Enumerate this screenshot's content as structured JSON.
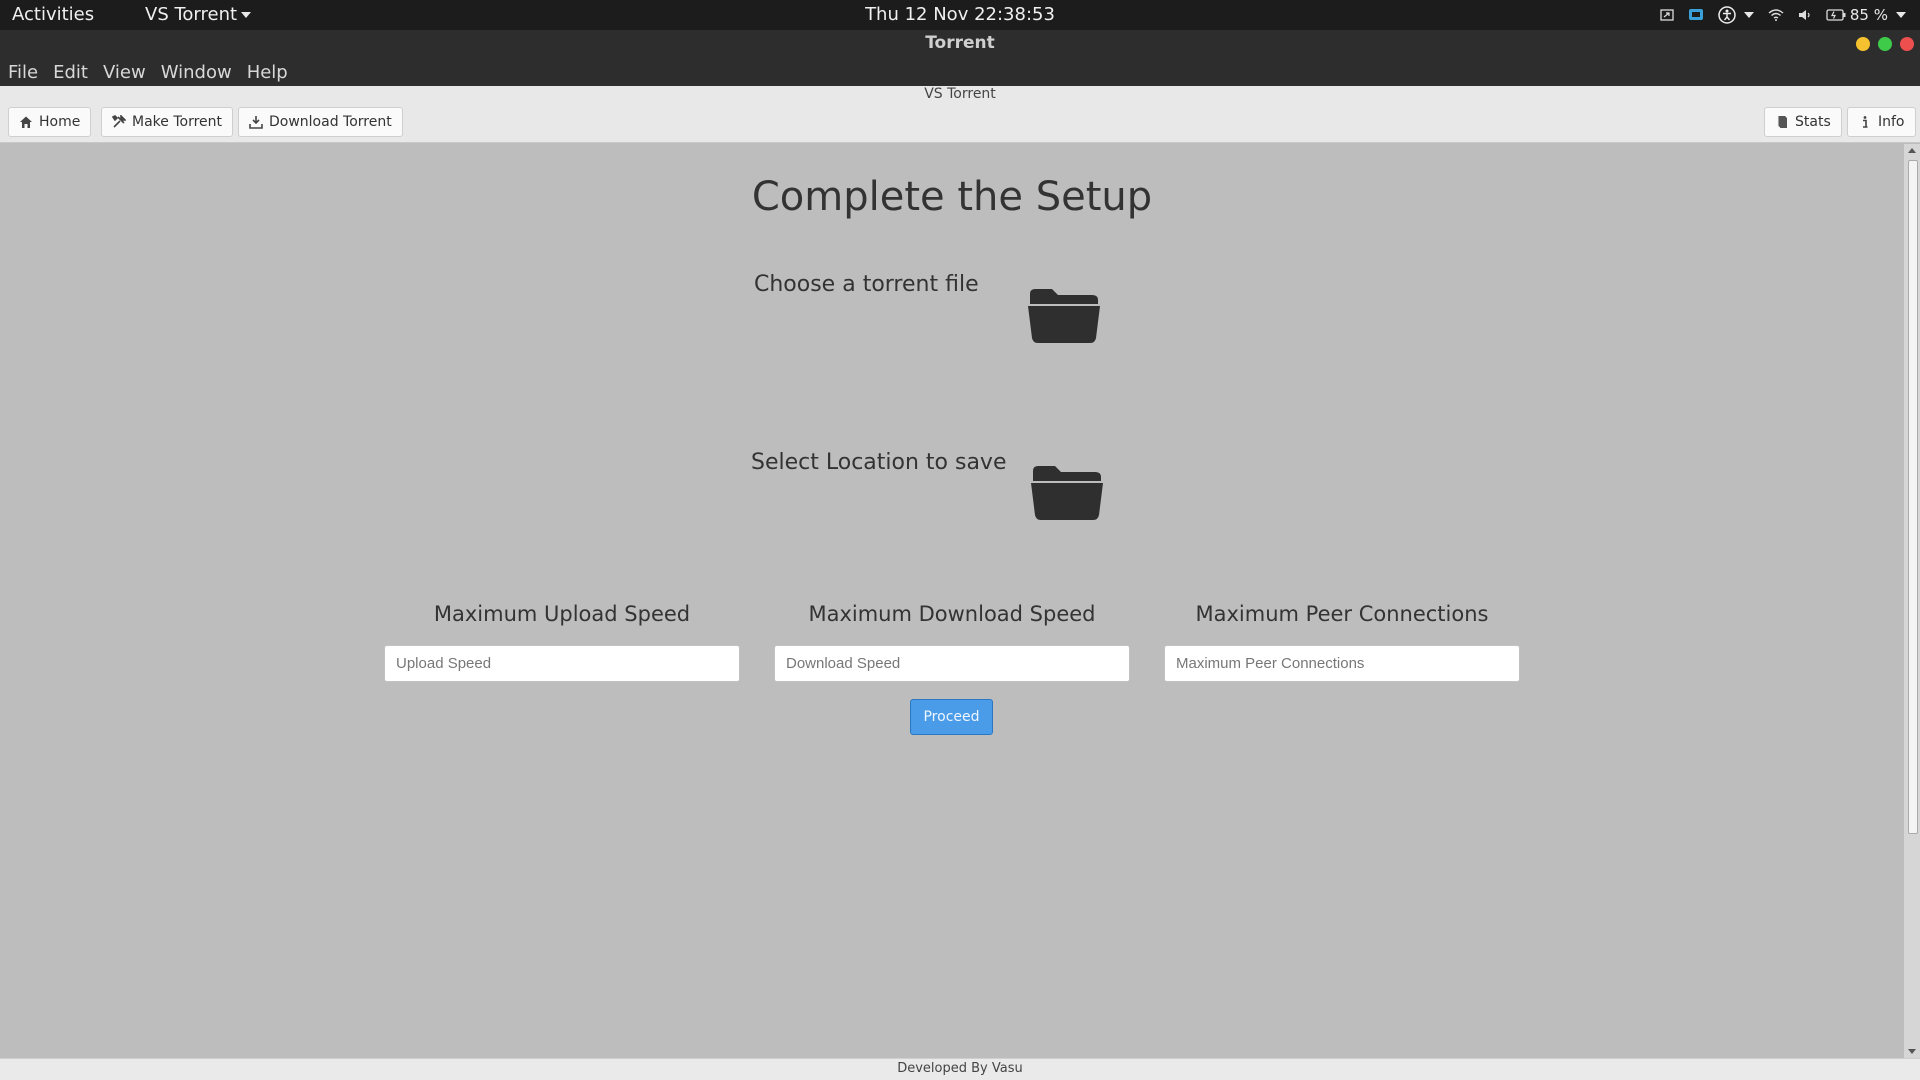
{
  "system": {
    "activities": "Activities",
    "app_menu": "VS Torrent",
    "clock": "Thu 12 Nov  22:38:53",
    "battery": "85 %"
  },
  "window": {
    "title": "Torrent",
    "buttons": [
      "minimize",
      "maximize",
      "close"
    ]
  },
  "menubar": [
    "File",
    "Edit",
    "View",
    "Window",
    "Help"
  ],
  "header": {
    "app_title": "VS Torrent",
    "left_buttons": [
      {
        "label": "Home",
        "icon": "home-icon"
      },
      {
        "label": "Make Torrent",
        "icon": "tools-icon"
      },
      {
        "label": "Download Torrent",
        "icon": "download-icon"
      }
    ],
    "right_buttons": [
      {
        "label": "Stats",
        "icon": "book-icon"
      },
      {
        "label": "Info",
        "icon": "info-icon"
      }
    ]
  },
  "main": {
    "heading": "Complete the Setup",
    "choose_file_label": "Choose a torrent file",
    "save_location_label": "Select Location to save",
    "upload": {
      "label": "Maximum Upload Speed",
      "placeholder": "Upload Speed",
      "value": ""
    },
    "download": {
      "label": "Maximum Download Speed",
      "placeholder": "Download Speed",
      "value": ""
    },
    "peers": {
      "label": "Maximum Peer Connections",
      "placeholder": "Maximum Peer Connections",
      "value": ""
    },
    "proceed_label": "Proceed"
  },
  "footer": "Developed By Vasu",
  "colors": {
    "background": "#bdbdbd",
    "primary_button": "#4a9ce8",
    "close": "#ed4f4f",
    "minimize": "#f5c12e",
    "maximize": "#3fcb4a"
  }
}
